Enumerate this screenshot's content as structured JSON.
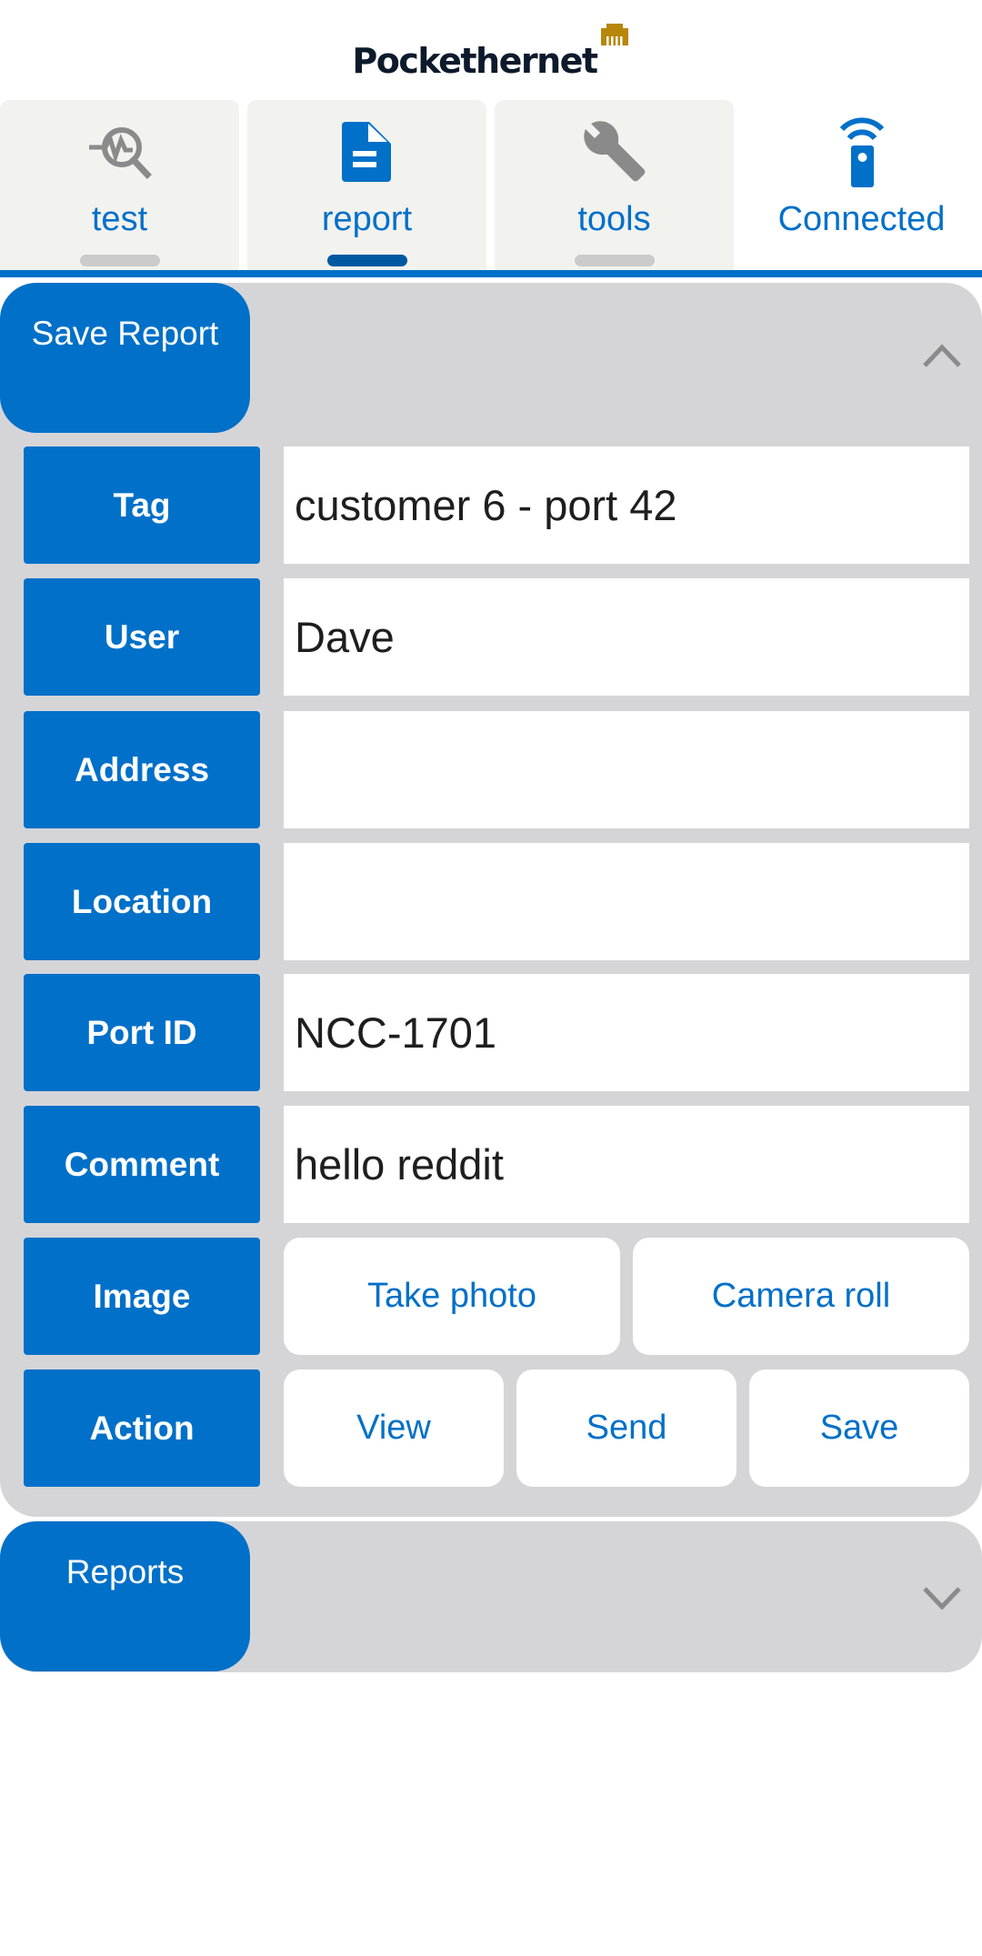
{
  "header": {
    "brand": "Pockethernet",
    "brand_mark_icon": "ethernet-port-icon",
    "brand_mark_color": "#b8860b"
  },
  "tabs": [
    {
      "label": "test",
      "icon": "search-pulse-icon",
      "active": false
    },
    {
      "label": "report",
      "icon": "document-icon",
      "active": true
    },
    {
      "label": "tools",
      "icon": "wrench-icon",
      "active": false
    },
    {
      "label": "Connected",
      "icon": "remote-signal-icon",
      "status": true
    }
  ],
  "save_panel": {
    "title": "Save Report",
    "expanded": true,
    "toggle_icon": "chevron-up-icon",
    "fields": [
      {
        "label": "Tag",
        "value": "customer 6 - port 42",
        "placeholder": ""
      },
      {
        "label": "User",
        "value": "Dave",
        "placeholder": ""
      },
      {
        "label": "Address",
        "value": "",
        "placeholder": ""
      },
      {
        "label": "Location",
        "value": "",
        "placeholder": ""
      },
      {
        "label": "Port ID",
        "value": "NCC-1701",
        "placeholder": ""
      },
      {
        "label": "Comment",
        "value": "hello reddit",
        "placeholder": ""
      }
    ],
    "image": {
      "label": "Image",
      "buttons": [
        "Take photo",
        "Camera roll"
      ]
    },
    "action": {
      "label": "Action",
      "buttons": [
        "View",
        "Send",
        "Save"
      ]
    }
  },
  "reports_panel": {
    "title": "Reports",
    "expanded": false,
    "toggle_icon": "chevron-down-icon"
  },
  "colors": {
    "accent": "#0070c9",
    "active_indicator": "#0059a0",
    "panel_bg": "#d5d5d8",
    "tab_bg": "#f2f2ef",
    "icon_gray": "#8a8a8a"
  }
}
